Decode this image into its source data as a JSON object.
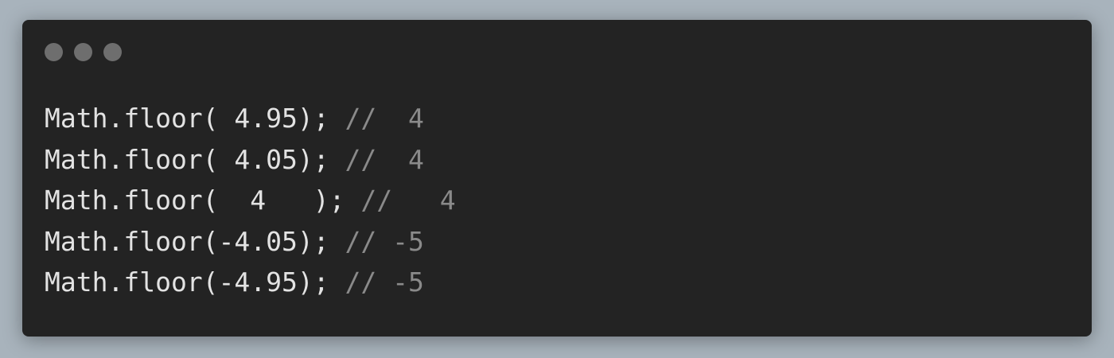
{
  "window": {
    "traffic_lights": [
      "close-dot",
      "minimize-dot",
      "maximize-dot"
    ]
  },
  "code": {
    "lines": [
      {
        "code": "Math.floor( 4.95); ",
        "comment": "//  4"
      },
      {
        "code": "Math.floor( 4.05); ",
        "comment": "//  4"
      },
      {
        "code": "Math.floor(  4   ); ",
        "comment": "//   4"
      },
      {
        "code": "Math.floor(-4.05); ",
        "comment": "// -5"
      },
      {
        "code": "Math.floor(-4.95); ",
        "comment": "// -5"
      }
    ]
  },
  "colors": {
    "background": "#a8b3bc",
    "window": "#232323",
    "dots": "#6e6e6e",
    "code_text": "#e3e3e3",
    "comment_text": "#8a8a8a"
  }
}
